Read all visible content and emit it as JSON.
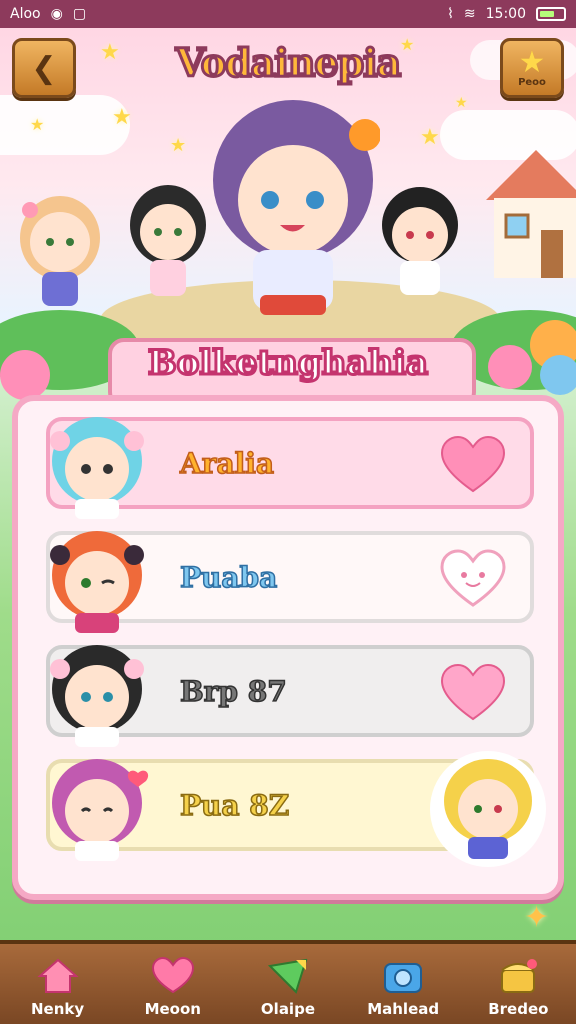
{
  "status": {
    "left_text": "Aloo",
    "time": "15:00"
  },
  "header": {
    "title": "Vodainepia",
    "back_icon": "chevron-left-icon",
    "star_label": "Peoo"
  },
  "subtitle": "Bolketnghahia",
  "characters": [
    {
      "name": "Aralia",
      "heart_style": "heart-icon"
    },
    {
      "name": "Puaba",
      "heart_style": "heart-face-icon"
    },
    {
      "name": "Brp 87",
      "heart_style": "heart-icon"
    },
    {
      "name": "Pua 8Z",
      "heart_style": "none"
    }
  ],
  "nav": [
    {
      "label": "Nenky",
      "icon": "home-icon",
      "color": "#ff8fb3"
    },
    {
      "label": "Meoon",
      "icon": "heart-icon",
      "color": "#ff7aa8"
    },
    {
      "label": "Olaipe",
      "icon": "ribbon-icon",
      "color": "#5ecb5e"
    },
    {
      "label": "Mahlead",
      "icon": "camera-icon",
      "color": "#4aa6e8"
    },
    {
      "label": "Bredeo",
      "icon": "treasure-icon",
      "color": "#f5c542"
    }
  ]
}
